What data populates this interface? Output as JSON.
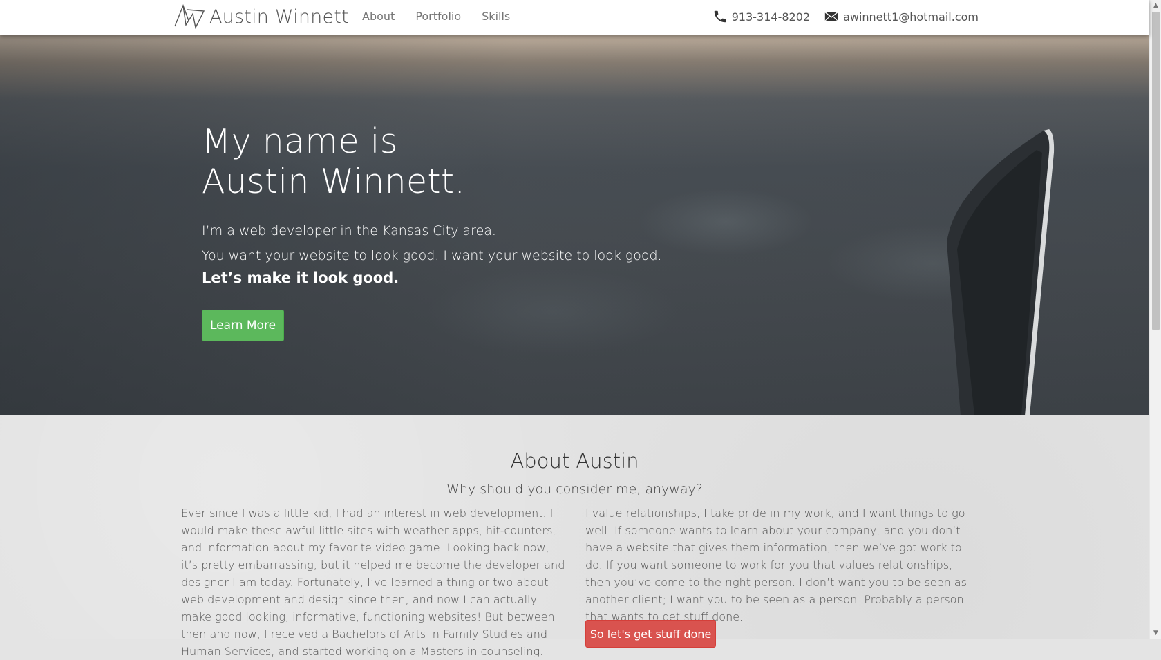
{
  "navbar": {
    "brand_name": "Austin Winnett",
    "links": [
      {
        "label": "About"
      },
      {
        "label": "Portfolio"
      },
      {
        "label": "Skills"
      }
    ],
    "phone": "913-314-8202",
    "email": "awinnett1@hotmail.com",
    "icons": {
      "brand": "aw-logo-icon",
      "phone": "phone-icon",
      "email": "envelope-icon"
    }
  },
  "hero": {
    "title_line_1": "My name is",
    "title_line_2": "Austin Winnett.",
    "line_1": "I’m a web developer in the Kansas City area.",
    "line_2": "You want your website to look good.  I want your website to look good.",
    "tagline": "Let’s make it look good.",
    "cta_label": "Learn More"
  },
  "about": {
    "title": "About Austin",
    "subtitle": "Why should you consider me, anyway?",
    "left_text": "Ever since I was a little kid, I had an interest in web development.  I would make these awful little sites with weather apps, hit-counters, and information about my favorite video game.  Looking back now, it’s pretty embarrassing, but it helped me become the developer and designer I am today.  Fortunately, I’ve learned a thing or two about web development and design since then, and now I can actually make good looking, informative, functioning websites!  But between then and now, I received a Bachelors of Arts in Family Studies and Human Services, and started working on a Masters in counseling.",
    "right_text": "I value relationships, I take pride in my work, and I want things to go well.  If someone wants to learn about your company, and you don’t have a website that gives them information, then we’ve got work to do.  If you want someone to work for you that values relationships, then you’ve come to the right person.  I don’t want you to be seen as another client; I want you to be seen as a person.  Probably a person that wants to get stuff done.",
    "cta_label": "So let's get stuff done"
  },
  "colors": {
    "accent_green": "#5cb85c",
    "accent_red": "#d9534f",
    "nav_background": "#ffffff"
  }
}
